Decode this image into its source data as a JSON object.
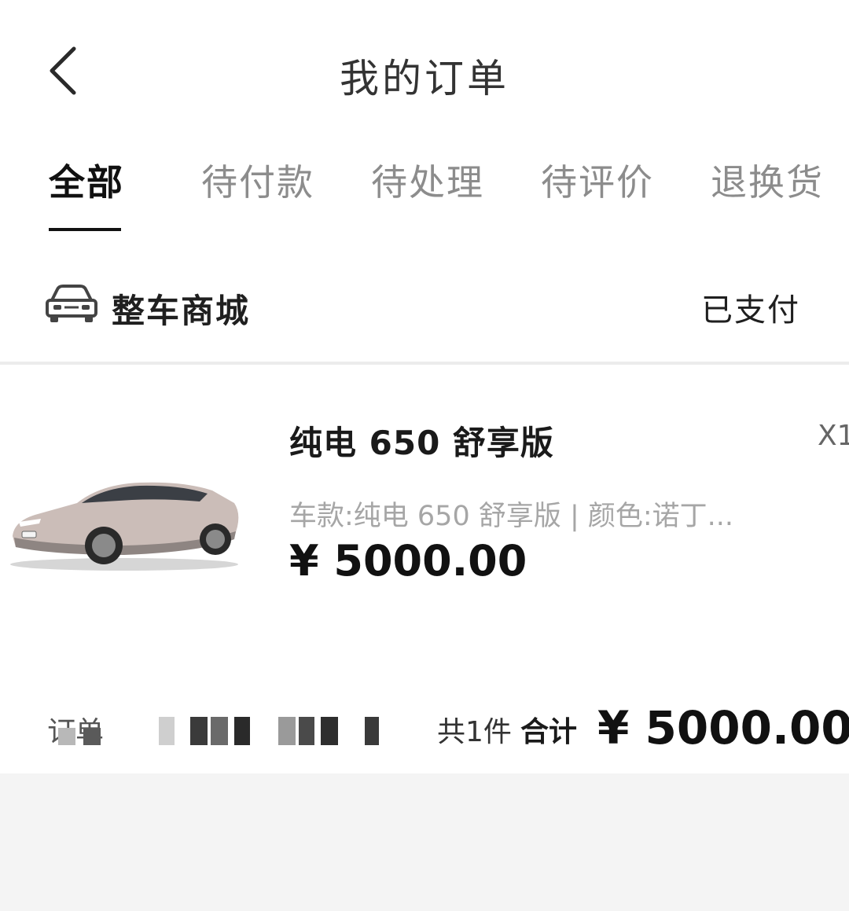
{
  "header": {
    "title": "我的订单",
    "back_icon": "chevron-left-icon"
  },
  "tabs": [
    {
      "label": "全部",
      "active": true
    },
    {
      "label": "待付款",
      "active": false
    },
    {
      "label": "待处理",
      "active": false
    },
    {
      "label": "待评价",
      "active": false
    },
    {
      "label": "退换货",
      "active": false
    }
  ],
  "order": {
    "store_icon": "car-icon",
    "store_name": "整车商城",
    "status": "已支付",
    "product": {
      "image": "car-photo",
      "name": "纯电 650 舒享版",
      "quantity": "X1",
      "spec": "车款:纯电 650 舒享版 | 颜色:诺丁...",
      "price": "¥ 5000.00"
    },
    "order_no_label": "订单",
    "item_count": "共1件",
    "total_label": "合计",
    "total_price": "¥ 5000.00"
  },
  "colors": {
    "background": "#f4f4f4",
    "card": "#ffffff",
    "text_primary": "#111111",
    "text_muted": "#8c8c8c",
    "spec_text": "#a6a6a6"
  }
}
